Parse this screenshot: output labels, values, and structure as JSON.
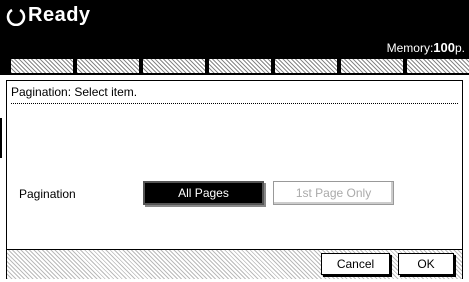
{
  "header": {
    "status_text": "Ready",
    "memory_label": "Memory:",
    "memory_value": "100",
    "memory_unit": "p."
  },
  "dialog": {
    "title": "Pagination: Select item.",
    "row_label": "Pagination",
    "options": [
      {
        "label": "All Pages",
        "state": "selected"
      },
      {
        "label": "1st Page Only",
        "state": "disabled"
      }
    ],
    "cancel_label": "Cancel",
    "ok_label": "OK"
  },
  "colors": {
    "header_bg": "#000000",
    "selected_bg": "#000000",
    "disabled_text": "#aaaaaa"
  }
}
